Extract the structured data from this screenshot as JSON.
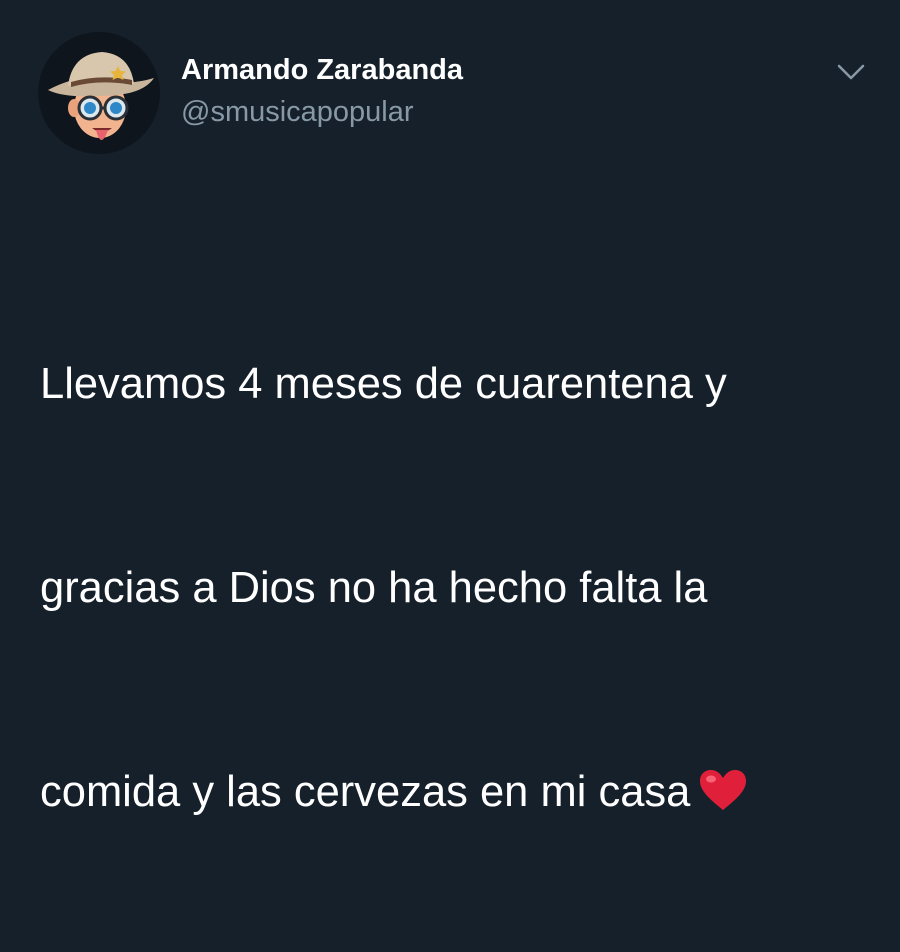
{
  "tweet": {
    "author": {
      "display_name": "Armando Zarabanda",
      "handle": "@smusicapopular",
      "avatar_icon": "cowboy-hat-memoji-avatar"
    },
    "menu_icon": "chevron-down-icon",
    "text_lines": [
      "Llevamos 4 meses de cuarentena y",
      "gracias a Dios no ha hecho falta la",
      "comida y las cervezas  en mi casa"
    ],
    "emoji": "heart-icon"
  },
  "colors": {
    "background": "#15202b",
    "text": "#ffffff",
    "secondary_text": "#8899a6",
    "heart": "#e0203a"
  }
}
